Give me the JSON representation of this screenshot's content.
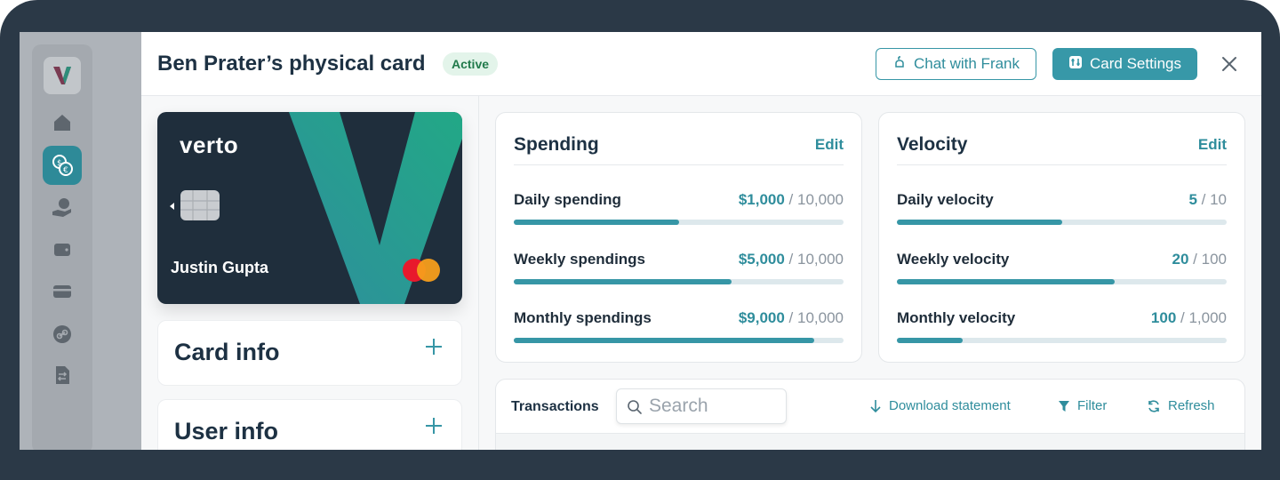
{
  "header": {
    "title": "Ben Prater’s physical card",
    "status_badge": "Active",
    "chat_button": "Chat with Frank",
    "settings_button": "Card Settings"
  },
  "card": {
    "brand": "verto",
    "holder": "Justin Gupta"
  },
  "accordions": [
    {
      "label": "Card info"
    },
    {
      "label": "User info"
    }
  ],
  "spending": {
    "title": "Spending",
    "edit": "Edit",
    "rows": [
      {
        "label": "Daily spending",
        "value": "$1,000",
        "limit": " / 10,000",
        "progress": 0.5
      },
      {
        "label": "Weekly spendings",
        "value": "$5,000",
        "limit": " / 10,000",
        "progress": 0.66
      },
      {
        "label": "Monthly spendings",
        "value": "$9,000",
        "limit": " / 10,000",
        "progress": 0.91
      }
    ]
  },
  "velocity": {
    "title": "Velocity",
    "edit": "Edit",
    "rows": [
      {
        "label": "Daily velocity",
        "value": "5",
        "limit": " / 10",
        "progress": 0.5
      },
      {
        "label": "Weekly velocity",
        "value": "20",
        "limit": " / 100",
        "progress": 0.66
      },
      {
        "label": "Monthly velocity",
        "value": "100",
        "limit": " / 1,000",
        "progress": 0.2
      }
    ]
  },
  "transactions": {
    "title": "Transactions",
    "search_placeholder": "Search",
    "download": "Download statement",
    "filter": "Filter",
    "refresh": "Refresh"
  },
  "colors": {
    "accent": "#3798a8",
    "active_badge_bg": "#e3f4ea",
    "active_badge_text": "#217a4b",
    "card_bg": "#1f2e3c"
  }
}
